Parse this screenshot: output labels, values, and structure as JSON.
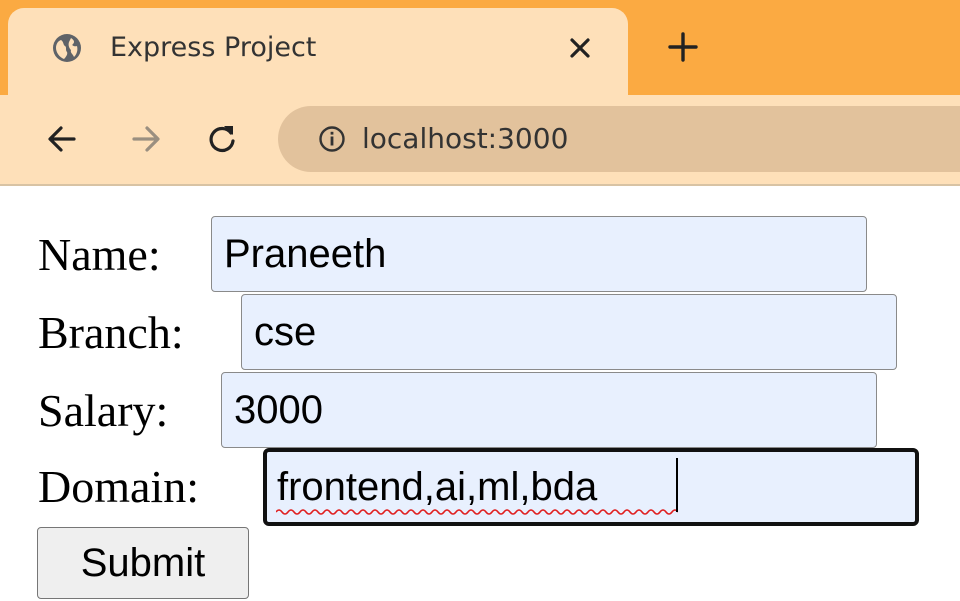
{
  "browser": {
    "tab": {
      "title": "Express Project",
      "favicon": "globe-icon",
      "close_icon": "close-icon"
    },
    "new_tab_icon": "plus-icon",
    "nav": {
      "back_icon": "arrow-left-icon",
      "forward_icon": "arrow-right-icon",
      "reload_icon": "reload-icon"
    },
    "address_bar": {
      "info_icon": "info-icon",
      "url": "localhost:3000"
    },
    "colors": {
      "tab_strip": "#fbaa42",
      "active_tab": "#fee0b9",
      "omnibox": "#e2c29c"
    }
  },
  "form": {
    "fields": [
      {
        "label": "Name:",
        "value": "Praneeth"
      },
      {
        "label": "Branch:",
        "value": "cse"
      },
      {
        "label": "Salary:",
        "value": "3000"
      },
      {
        "label": "Domain:",
        "value": "frontend,ai,ml,bda",
        "focused": true,
        "spellcheck_error": true
      }
    ],
    "submit_label": "Submit",
    "colors": {
      "input_autofill_bg": "#e8f0fe",
      "focus_border": "#111111"
    }
  }
}
